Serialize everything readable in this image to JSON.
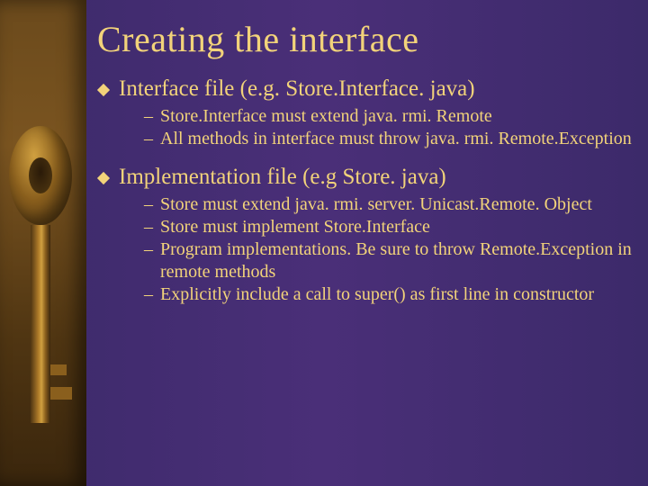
{
  "title": "Creating the interface",
  "bullets": [
    {
      "text": "Interface file (e.g. Store.Interface. java)",
      "sub": [
        "Store.Interface must extend java. rmi. Remote",
        "All  methods in interface must throw java. rmi. Remote.Exception"
      ]
    },
    {
      "text": "Implementation file (e.g Store. java)",
      "sub": [
        "Store must extend java. rmi. server. Unicast.Remote. Object",
        "Store must implement Store.Interface",
        "Program implementations. Be sure to throw Remote.Exception in remote methods",
        "Explicitly include a call to super() as first line in constructor"
      ]
    }
  ]
}
